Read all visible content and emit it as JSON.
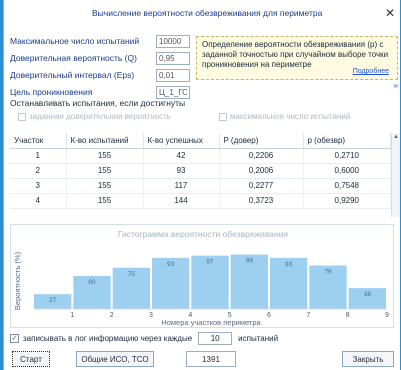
{
  "window": {
    "title": "Вычисление вероятности обезвреживания для периметра"
  },
  "params": [
    {
      "label": "Максимальное число испытаний",
      "value": "10000"
    },
    {
      "label": "Доверительная вероятность (Q)",
      "value": "0,95"
    },
    {
      "label": "Доверительный интервал (Eps)",
      "value": "0,01"
    },
    {
      "label": "Цель проникновения",
      "value": "Ц_1_ГО"
    }
  ],
  "info": {
    "text": "Определение вероятности обезвреживания (p) с заданной точностью при случайном выборе точки проникновения на периметре",
    "link": "Подробнее",
    "chevron": "»"
  },
  "stop": {
    "label": "Останавливать испытания, если достигнуты",
    "option_a": "заданная доверительная вероятность",
    "option_b": "максимальное число испытаний"
  },
  "table": {
    "headers": [
      "Участок",
      "К-во испытаний",
      "К-во успешных",
      "P (довер)",
      "p (обезвр)"
    ],
    "rows": [
      [
        "1",
        "155",
        "42",
        "0,2206",
        "0,2710"
      ],
      [
        "2",
        "155",
        "93",
        "0,2006",
        "0,6000"
      ],
      [
        "3",
        "155",
        "117",
        "0,2277",
        "0,7548"
      ],
      [
        "4",
        "155",
        "144",
        "0,3723",
        "0,9290"
      ]
    ]
  },
  "chart_data": {
    "type": "bar",
    "title": "Гистограмма вероятности обезвреживания",
    "xlabel": "Номера участков периметра",
    "ylabel": "Вероятность (%)",
    "categories": [
      "1",
      "2",
      "3",
      "4",
      "5",
      "6",
      "7",
      "8",
      "9"
    ],
    "values": [
      27,
      60,
      75,
      93,
      97,
      99,
      93,
      79,
      38
    ],
    "value_labels": [
      "27",
      "60",
      "75",
      "93",
      "97",
      "99",
      "93",
      "79",
      "38"
    ],
    "ylim": [
      0,
      120
    ],
    "bar_color": "#9dcff0",
    "grid": false
  },
  "log": {
    "label": "записывать в лог информацию через каждые",
    "value": "10",
    "suffix": "испытаний"
  },
  "buttons": {
    "start": "Старт",
    "general": "Общие ИСО, ТСО",
    "counter": "1391",
    "close": "Закрыть"
  }
}
